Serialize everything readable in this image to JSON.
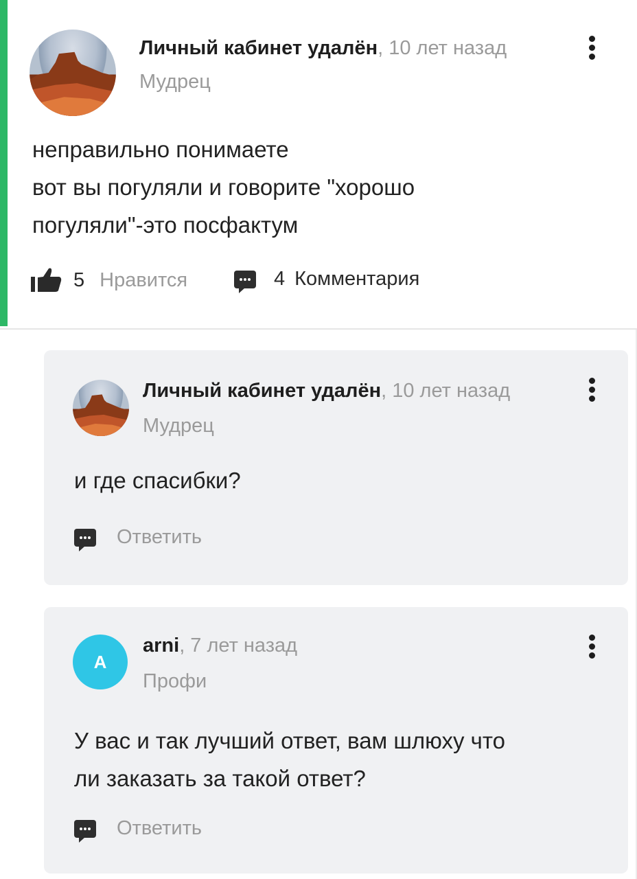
{
  "question": {
    "author": "Личный кабинет удалён",
    "time": ", 10 лет назад",
    "rank": "Мудрец",
    "text_lines": [
      "неправильно понимаете",
      "вот вы погуляли и говорите \"хорошо",
      "погуляли\"-это посфактум"
    ],
    "likes": "5",
    "like_label": "Нравится",
    "comments": "4",
    "comments_label": "Комментария",
    "accent_color": "#2db866"
  },
  "replies": [
    {
      "author": "Личный кабинет удалён",
      "time": ", 10 лет назад",
      "rank": "Мудрец",
      "text_lines": [
        "и где спасибки?"
      ],
      "reply_label": "Ответить"
    },
    {
      "author": "arni",
      "time": ", 7 лет назад",
      "rank": "Профи",
      "avatar_letter": "A",
      "avatar_color": "#2fc6e6",
      "text_lines": [
        "У вас и так лучший ответ, вам шлюху что",
        "ли заказать за такой ответ?"
      ],
      "reply_label": "Ответить"
    }
  ],
  "icons": [
    "kebab-menu-icon",
    "thumbs-up-icon",
    "comment-icon"
  ]
}
